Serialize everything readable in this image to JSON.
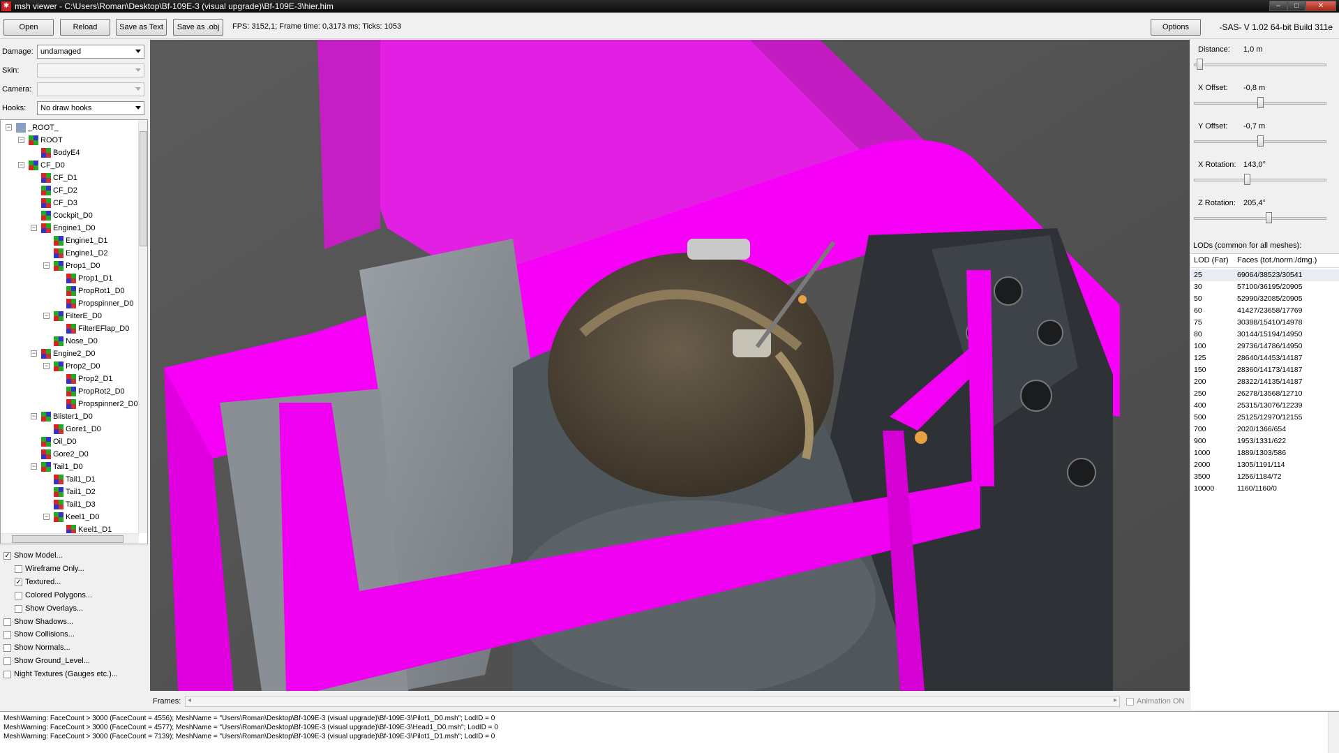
{
  "window": {
    "title": "msh viewer - C:\\Users\\Roman\\Desktop\\Bf-109E-3 (visual upgrade)\\Bf-109E-3\\hier.him",
    "minimize": "–",
    "maximize": "□",
    "close": "✕",
    "app_icon": "✱"
  },
  "toolbar": {
    "open": "Open",
    "reload": "Reload",
    "save_text": "Save as Text",
    "save_obj": "Save as .obj",
    "fps": "FPS: 3152,1; Frame time: 0,3173 ms; Ticks: 1053",
    "options": "Options",
    "version": "-SAS- V 1.02  64-bit  Build 311e"
  },
  "left": {
    "damage_label": "Damage:",
    "damage_value": "undamaged",
    "skin_label": "Skin:",
    "skin_value": "",
    "camera_label": "Camera:",
    "camera_value": "",
    "hooks_label": "Hooks:",
    "hooks_value": "No draw hooks"
  },
  "tree": [
    {
      "label": "_ROOT_",
      "level": 0,
      "expander": "−",
      "root": true
    },
    {
      "label": "ROOT",
      "level": 1,
      "expander": "−"
    },
    {
      "label": "BodyE4",
      "level": 2,
      "expander": ""
    },
    {
      "label": "CF_D0",
      "level": 1,
      "expander": "−"
    },
    {
      "label": "CF_D1",
      "level": 2,
      "expander": ""
    },
    {
      "label": "CF_D2",
      "level": 2,
      "expander": ""
    },
    {
      "label": "CF_D3",
      "level": 2,
      "expander": ""
    },
    {
      "label": "Cockpit_D0",
      "level": 2,
      "expander": ""
    },
    {
      "label": "Engine1_D0",
      "level": 2,
      "expander": "−"
    },
    {
      "label": "Engine1_D1",
      "level": 3,
      "expander": ""
    },
    {
      "label": "Engine1_D2",
      "level": 3,
      "expander": ""
    },
    {
      "label": "Prop1_D0",
      "level": 3,
      "expander": "−"
    },
    {
      "label": "Prop1_D1",
      "level": 4,
      "expander": ""
    },
    {
      "label": "PropRot1_D0",
      "level": 4,
      "expander": ""
    },
    {
      "label": "Propspinner_D0",
      "level": 4,
      "expander": ""
    },
    {
      "label": "FilterE_D0",
      "level": 3,
      "expander": "−"
    },
    {
      "label": "FilterEFlap_D0",
      "level": 4,
      "expander": ""
    },
    {
      "label": "Nose_D0",
      "level": 3,
      "expander": ""
    },
    {
      "label": "Engine2_D0",
      "level": 2,
      "expander": "−"
    },
    {
      "label": "Prop2_D0",
      "level": 3,
      "expander": "−"
    },
    {
      "label": "Prop2_D1",
      "level": 4,
      "expander": ""
    },
    {
      "label": "PropRot2_D0",
      "level": 4,
      "expander": ""
    },
    {
      "label": "Propspinner2_D0",
      "level": 4,
      "expander": ""
    },
    {
      "label": "Blister1_D0",
      "level": 2,
      "expander": "−"
    },
    {
      "label": "Gore1_D0",
      "level": 3,
      "expander": ""
    },
    {
      "label": "Oil_D0",
      "level": 2,
      "expander": ""
    },
    {
      "label": "Gore2_D0",
      "level": 2,
      "expander": ""
    },
    {
      "label": "Tail1_D0",
      "level": 2,
      "expander": "−"
    },
    {
      "label": "Tail1_D1",
      "level": 3,
      "expander": ""
    },
    {
      "label": "Tail1_D2",
      "level": 3,
      "expander": ""
    },
    {
      "label": "Tail1_D3",
      "level": 3,
      "expander": ""
    },
    {
      "label": "Keel1_D0",
      "level": 3,
      "expander": "−"
    },
    {
      "label": "Keel1_D1",
      "level": 4,
      "expander": ""
    }
  ],
  "options": [
    {
      "label": "Show Model...",
      "checked": true,
      "indent": false
    },
    {
      "label": "Wireframe Only...",
      "checked": false,
      "indent": true
    },
    {
      "label": "Textured...",
      "checked": true,
      "indent": true
    },
    {
      "label": "Colored Polygons...",
      "checked": false,
      "indent": true
    },
    {
      "label": "Show Overlays...",
      "checked": false,
      "indent": true
    },
    {
      "label": "Show Shadows...",
      "checked": false,
      "indent": false
    },
    {
      "label": "Show Collisions...",
      "checked": false,
      "indent": false
    },
    {
      "label": "Show Normals...",
      "checked": false,
      "indent": false
    },
    {
      "label": "Show Ground_Level...",
      "checked": false,
      "indent": false
    },
    {
      "label": "Night Textures (Gauges etc.)...",
      "checked": false,
      "indent": false
    }
  ],
  "frames": {
    "label": "Frames:",
    "animation": "Animation ON",
    "left_arrow": "◂",
    "right_arrow": "▸"
  },
  "right": {
    "distance_label": "Distance:",
    "distance_value": "1,0 m",
    "distance_level": 0.02,
    "xoffset_label": "X Offset:",
    "xoffset_value": "-0,8 m",
    "xoffset_level": 0.5,
    "yoffset_label": "Y Offset:",
    "yoffset_value": "-0,7 m",
    "yoffset_level": 0.5,
    "xrot_label": "X Rotation:",
    "xrot_value": "143,0°",
    "xrot_level": 0.4,
    "zrot_label": "Z Rotation:",
    "zrot_value": "205,4°",
    "zrot_level": 0.57,
    "lods_title": "LODs (common for all meshes):",
    "lod_col1": "LOD (Far)",
    "lod_col2": "Faces (tot./norm./dmg.)"
  },
  "lods": [
    {
      "far": "25",
      "faces": "69064/38523/30541"
    },
    {
      "far": "30",
      "faces": "57100/36195/20905"
    },
    {
      "far": "50",
      "faces": "52990/32085/20905"
    },
    {
      "far": "60",
      "faces": "41427/23658/17769"
    },
    {
      "far": "75",
      "faces": "30388/15410/14978"
    },
    {
      "far": "80",
      "faces": "30144/15194/14950"
    },
    {
      "far": "100",
      "faces": "29736/14786/14950"
    },
    {
      "far": "125",
      "faces": "28640/14453/14187"
    },
    {
      "far": "150",
      "faces": "28360/14173/14187"
    },
    {
      "far": "200",
      "faces": "28322/14135/14187"
    },
    {
      "far": "250",
      "faces": "26278/13568/12710"
    },
    {
      "far": "400",
      "faces": "25315/13076/12239"
    },
    {
      "far": "500",
      "faces": "25125/12970/12155"
    },
    {
      "far": "700",
      "faces": "2020/1366/654"
    },
    {
      "far": "900",
      "faces": "1953/1331/622"
    },
    {
      "far": "1000",
      "faces": "1889/1303/586"
    },
    {
      "far": "2000",
      "faces": "1305/1191/114"
    },
    {
      "far": "3500",
      "faces": "1256/1184/72"
    },
    {
      "far": "10000",
      "faces": "1160/1160/0"
    }
  ],
  "log": [
    "MeshWarning: FaceCount > 3000 (FaceCount = 4556); MeshName = \"Users\\Roman\\Desktop\\Bf-109E-3 (visual upgrade)\\Bf-109E-3\\Pilot1_D0.msh\"; LodID = 0",
    "MeshWarning: FaceCount > 3000 (FaceCount = 4577); MeshName = \"Users\\Roman\\Desktop\\Bf-109E-3 (visual upgrade)\\Bf-109E-3\\Head1_D0.msh\"; LodID = 0",
    "MeshWarning: FaceCount > 3000 (FaceCount = 7139); MeshName = \"Users\\Roman\\Desktop\\Bf-109E-3 (visual upgrade)\\Bf-109E-3\\Pilot1_D1.msh\"; LodID = 0"
  ],
  "colors": {
    "magenta": "#ff00ff",
    "background": "#565656",
    "panel": "#f0f0f0",
    "selected_row": "#e8ecf3"
  }
}
